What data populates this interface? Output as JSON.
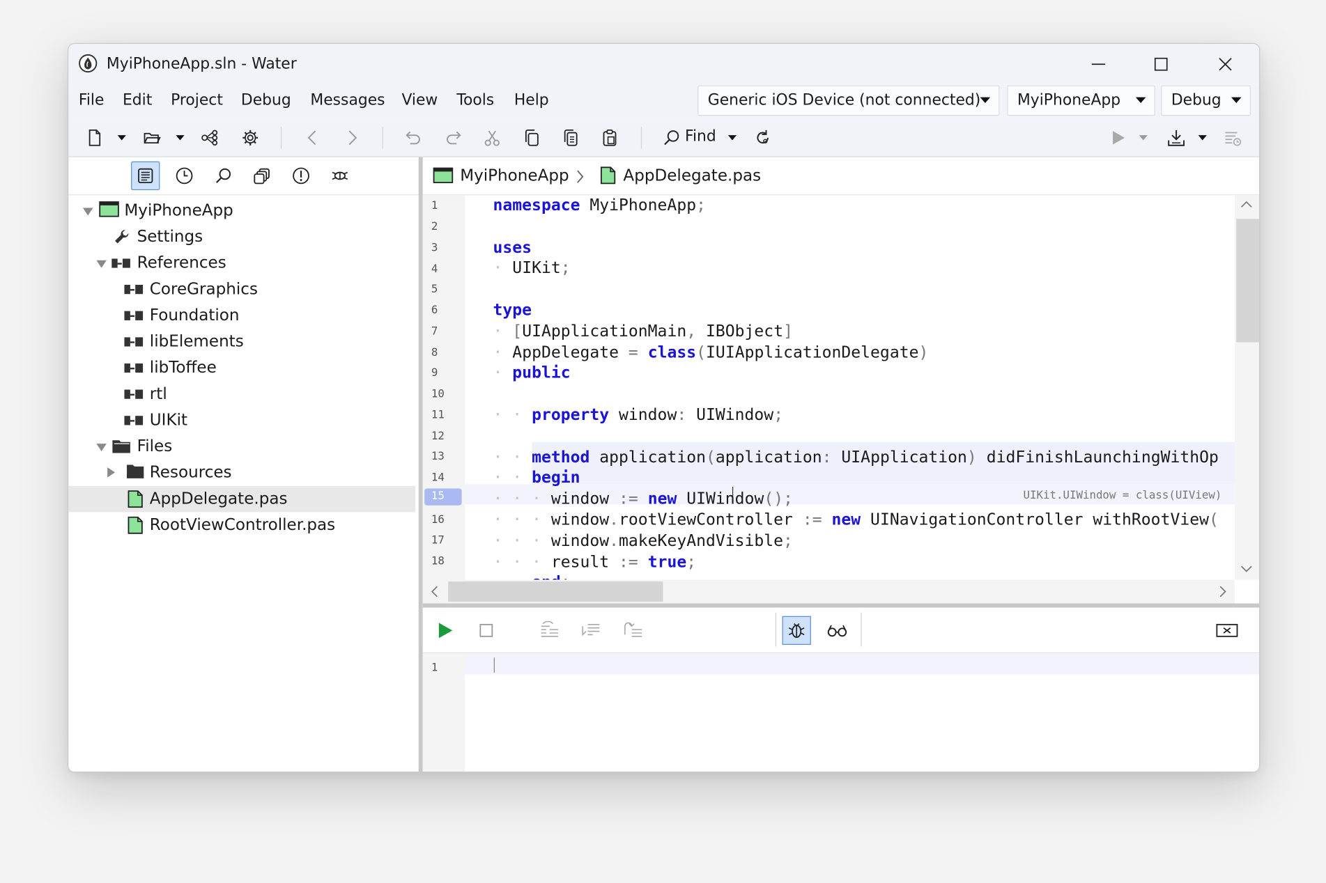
{
  "window": {
    "title": "MyiPhoneApp.sln - Water",
    "controls": [
      "minimize",
      "maximize",
      "close"
    ]
  },
  "menu": [
    "File",
    "Edit",
    "Project",
    "Debug",
    "Messages",
    "View",
    "Tools",
    "Help"
  ],
  "combos": {
    "device": "Generic iOS Device (not connected)",
    "project": "MyiPhoneApp",
    "configuration": "Debug"
  },
  "toolbar": {
    "find_label": "Find"
  },
  "sidebar": {
    "tabs": [
      "solution-view",
      "history",
      "search",
      "copies",
      "issues",
      "debug"
    ],
    "tree": [
      {
        "label": "MyiPhoneApp",
        "type": "project",
        "expanded": true
      },
      {
        "label": "Settings",
        "type": "settings"
      },
      {
        "label": "References",
        "type": "folder",
        "expanded": true
      },
      {
        "label": "CoreGraphics",
        "type": "reference"
      },
      {
        "label": "Foundation",
        "type": "reference"
      },
      {
        "label": "libElements",
        "type": "reference"
      },
      {
        "label": "libToffee",
        "type": "reference"
      },
      {
        "label": "rtl",
        "type": "reference"
      },
      {
        "label": "UIKit",
        "type": "reference"
      },
      {
        "label": "Files",
        "type": "folder",
        "expanded": true
      },
      {
        "label": "Resources",
        "type": "folder",
        "expanded": false
      },
      {
        "label": "AppDelegate.pas",
        "type": "file",
        "selected": true
      },
      {
        "label": "RootViewController.pas",
        "type": "file"
      }
    ]
  },
  "breadcrumb": {
    "project": "MyiPhoneApp",
    "file": "AppDelegate.pas"
  },
  "editor": {
    "current_line": 15,
    "line_numbers": [
      "1",
      "2",
      "3",
      "4",
      "5",
      "6",
      "7",
      "8",
      "9",
      "10",
      "11",
      "12",
      "13",
      "14",
      "15",
      "16",
      "17",
      "18"
    ],
    "lines": [
      {
        "text": "namespace MyiPhoneApp;"
      },
      {
        "text": ""
      },
      {
        "text": "uses"
      },
      {
        "text": "  UIKit;"
      },
      {
        "text": ""
      },
      {
        "text": "type"
      },
      {
        "text": "  [UIApplicationMain, IBObject]"
      },
      {
        "text": "  AppDelegate = class(IUIApplicationDelegate)"
      },
      {
        "text": "  public"
      },
      {
        "text": ""
      },
      {
        "text": "    property window: UIWindow;"
      },
      {
        "text": ""
      },
      {
        "text": "    method application(application: UIApplication) didFinishLaunchingWithOp"
      },
      {
        "text": "    begin"
      },
      {
        "text": "      window := new UIWindow();"
      },
      {
        "text": "      window.rootViewController := new UINavigationController withRootView("
      },
      {
        "text": "      window.makeKeyAndVisible;"
      },
      {
        "text": "      result := true;"
      },
      {
        "text": "    end;"
      }
    ],
    "inline_hint": "UIKit.UIWindow = class(UIView)"
  },
  "output": {
    "line_numbers": [
      "1"
    ]
  },
  "colors": {
    "keyword": "#1a14d6",
    "chrome": "#f0f4f9",
    "selection": "#cfe2fb",
    "run_green": "#1a9c3a",
    "file_green": "#4caf50"
  }
}
